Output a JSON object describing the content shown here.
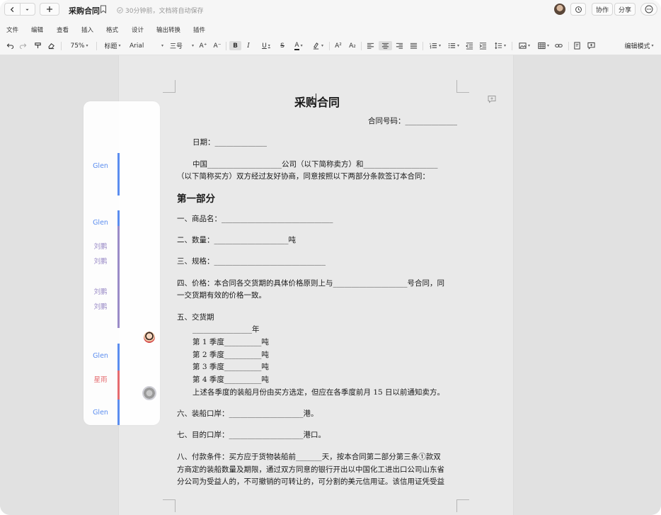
{
  "titlebar": {
    "doc_title": "采购合同",
    "save_status": "30分钟前，文档将自动保存",
    "collab_label": "协作",
    "share_label": "分享"
  },
  "menu": [
    "文件",
    "编辑",
    "查看",
    "插入",
    "格式",
    "设计",
    "输出转换",
    "插件"
  ],
  "toolbar": {
    "zoom": "75%",
    "style": "标题",
    "font": "Arial",
    "size": "三号",
    "grow": "A⁺",
    "shrink": "A⁻",
    "bold": "B",
    "italic": "I",
    "underline": "U",
    "strike": "S",
    "font_color": "A",
    "superscript": "A²",
    "subscript": "A₂",
    "mode": "编辑模式"
  },
  "document": {
    "title": "采购合同",
    "contract_no": "合同号码：______________",
    "date": "日期：______________",
    "parties_1": "中国____________________公司（以下简称卖方）和____________________",
    "parties_2": "（以下简称买方）双方经过友好协商，同意按照以下两部分条款签订本合同：",
    "part1": "第一部分",
    "item1": "一、商品名：______________________________",
    "item2": "二、数量：____________________吨",
    "item3": "三、规格：______________________________",
    "item4a": "四、价格：本合同各交货期的具体价格原则上与____________________号合同，同",
    "item4b": "一交货期有效的价格一致。",
    "item5": "五、交货期",
    "item5_year": "________________年",
    "q1": "第 1 季度__________吨",
    "q2": "第 2 季度__________吨",
    "q3": "第 3 季度__________吨",
    "q4": "第 4 季度__________吨",
    "item5_note": "上述各季度的装船月份由买方选定，但应在各季度前月 15 日以前通知卖方。",
    "item6": "六、装船口岸：____________________港。",
    "item7": "七、目的口岸：____________________港口。",
    "item8a": "八、付款条件：买方应于货物装船前_______天，按本合同第二部分第三条①款双",
    "item8b": "方商定的装船数量及期限，通过双方同意的银行开出以中国化工进出口公司山东省",
    "item8c": "分公司为受益人的，不可撤销的可转让的，可分割的美元信用证。该信用证凭受益"
  },
  "comments": {
    "authors": [
      {
        "name": "Glen",
        "color": "#5b8def"
      },
      {
        "name": "Glen",
        "color": "#5b8def"
      },
      {
        "name": "刘鹏",
        "color": "#9a8bc7"
      },
      {
        "name": "刘鹏",
        "color": "#9a8bc7"
      },
      {
        "name": "刘鹏",
        "color": "#9a8bc7"
      },
      {
        "name": "刘鹏",
        "color": "#9a8bc7"
      },
      {
        "name": "Glen",
        "color": "#5b8def"
      },
      {
        "name": "星雨",
        "color": "#e56b6f"
      },
      {
        "name": "Glen",
        "color": "#5b8def"
      }
    ]
  },
  "colors": {
    "glen": "#5b8def",
    "liupeng": "#9a8bc7",
    "xingyu": "#e56b6f"
  }
}
